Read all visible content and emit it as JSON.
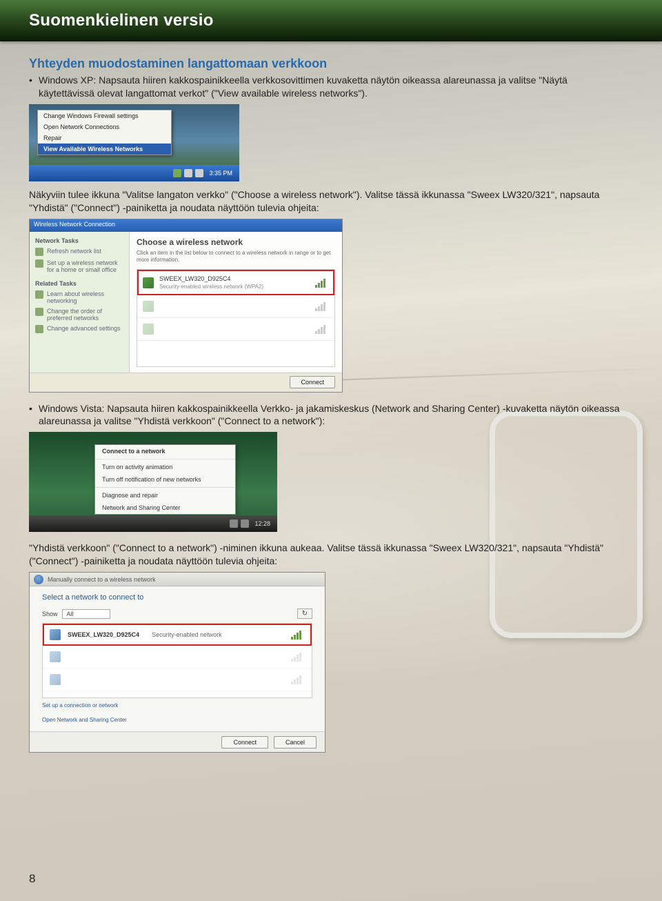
{
  "header": {
    "title": "Suomenkielinen versio"
  },
  "h1": "Yhteyden muodostaminen langattomaan verkkoon",
  "p1": "Windows XP: Napsauta hiiren kakkospainikkeella verkkosovittimen kuvaketta näytön oikeassa alareunassa ja valitse \"Näytä käytettävissä olevat langattomat verkot\" (\"View available wireless networks\").",
  "shot1": {
    "m1": "Change Windows Firewall settings",
    "m2": "Open Network Connections",
    "m3": "Repair",
    "m4": "View Available Wireless Networks",
    "clock": "3:35 PM"
  },
  "p2": "Näkyviin tulee ikkuna \"Valitse langaton verkko\" (\"Choose a wireless network\"). Valitse tässä ikkunassa \"Sweex LW320/321\", napsauta \"Yhdistä\" (\"Connect\") -painiketta ja noudata näyttöön tulevia ohjeita:",
  "shot2": {
    "title": "Wireless Network Connection",
    "left_h1": "Network Tasks",
    "left_i1": "Refresh network list",
    "left_i2": "Set up a wireless network for a home or small office",
    "left_h2": "Related Tasks",
    "left_i3": "Learn about wireless networking",
    "left_i4": "Change the order of preferred networks",
    "left_i5": "Change advanced settings",
    "right_h": "Choose a wireless network",
    "right_sub": "Click an item in the list below to connect to a wireless network in range or to get more information.",
    "net1_name": "SWEEX_LW320_D925C4",
    "net1_sub": "Security-enabled wireless network (WPA2)",
    "btn": "Connect"
  },
  "p3": "Windows Vista: Napsauta hiiren kakkospainikkeella Verkko- ja jakamiskeskus (Network and Sharing Center) -kuvaketta näytön oikeassa alareunassa ja valitse \"Yhdistä verkkoon\" (\"Connect to a network\"):",
  "shot3": {
    "m1": "Connect to a network",
    "m2": "Turn on activity animation",
    "m3": "Turn off notification of new networks",
    "m4": "Diagnose and repair",
    "m5": "Network and Sharing Center",
    "clock": "12:28"
  },
  "p4": "\"Yhdistä verkkoon\" (\"Connect to a network\") -niminen ikkuna aukeaa. Valitse tässä ikkunassa \"Sweex LW320/321\", napsauta \"Yhdistä\" (\"Connect\") -painiketta ja noudata näyttöön tulevia ohjeita:",
  "shot4": {
    "title": "Manually connect to a wireless network",
    "h": "Select a network to connect to",
    "show": "Show",
    "all": "All",
    "net1_name": "SWEEX_LW320_D925C4",
    "net1_desc": "Security-enabled network",
    "link1": "Set up a connection or network",
    "link2": "Open Network and Sharing Center",
    "btn1": "Connect",
    "btn2": "Cancel"
  },
  "page": "8"
}
